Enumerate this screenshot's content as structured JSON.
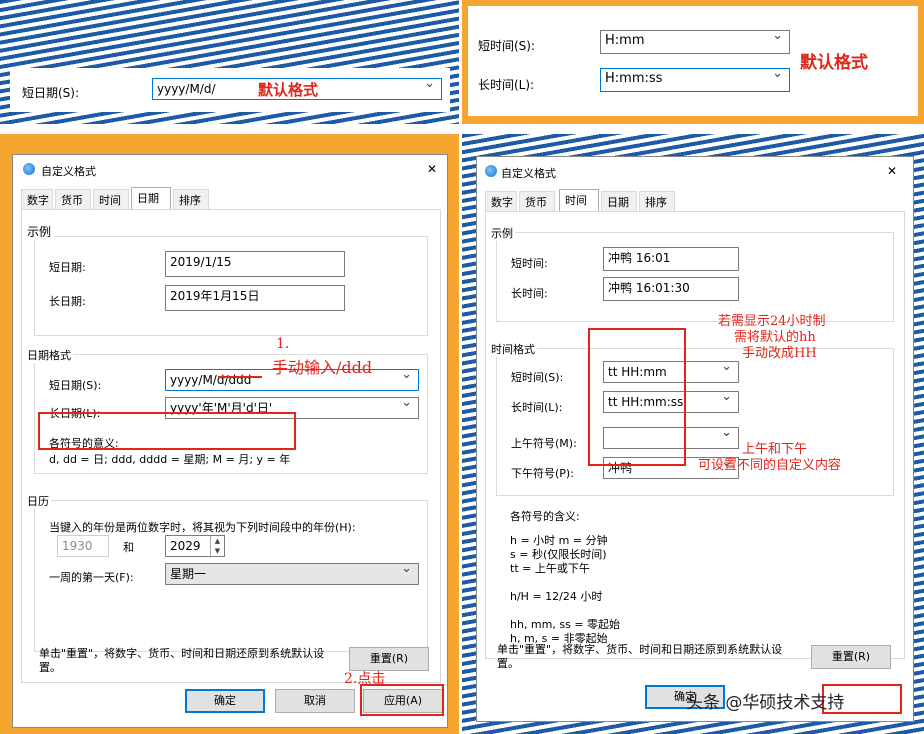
{
  "top_left": {
    "short_date_label": "短日期(S):",
    "short_date_value": "yyyy/M/d/",
    "note": "默认格式"
  },
  "top_right": {
    "short_time_label": "短时间(S):",
    "short_time_value": "H:mm",
    "long_time_label": "长时间(L):",
    "long_time_value": "H:mm:ss",
    "note": "默认格式"
  },
  "left_dialog": {
    "title": "自定义格式",
    "close": "✕",
    "tabs": [
      "数字",
      "货币",
      "时间",
      "日期",
      "排序"
    ],
    "active_tab": "日期",
    "example_group": "示例",
    "short_date_label": "短日期:",
    "short_date_value": "2019/1/15",
    "long_date_label": "长日期:",
    "long_date_value": "2019年1月15日",
    "format_group": "日期格式",
    "short_fmt_label": "短日期(S):",
    "short_fmt_value": "yyyy/M/d/ddd",
    "long_fmt_label": "长日期(L):",
    "long_fmt_value": "yyyy'年'M'月'd'日'",
    "meaning_title": "各符号的意义:",
    "meaning_text": "d, dd = 日;  ddd, dddd = 星期;  M = 月;  y = 年",
    "calendar_group": "日历",
    "calendar_desc": "当键入的年份是两位数字时，将其视为下列时间段中的年份(H):",
    "year_from": "1930",
    "and_label": "和",
    "year_to": "2029",
    "first_day_label": "一周的第一天(F):",
    "first_day_value": "星期一",
    "reset_desc": "单击\"重置\"，将数字、货币、时间和日期还原到系统默认设置。",
    "reset_button": "重置(R)",
    "ok_button": "确定",
    "cancel_button": "取消",
    "apply_button": "应用(A)",
    "annot_step1": "1.",
    "annot_manual": "手动输入/ddd",
    "annot_step2": "2.点击"
  },
  "right_dialog": {
    "title": "自定义格式",
    "close": "✕",
    "tabs": [
      "数字",
      "货币",
      "时间",
      "日期",
      "排序"
    ],
    "active_tab": "时间",
    "example_group": "示例",
    "short_time_label": "短时间:",
    "short_time_value": "冲鸭 16:01",
    "long_time_label": "长时间:",
    "long_time_value": "冲鸭 16:01:30",
    "format_group": "时间格式",
    "short_fmt_label": "短时间(S):",
    "short_fmt_value": "tt HH:mm",
    "long_fmt_label": "长时间(L):",
    "long_fmt_value": "tt HH:mm:ss",
    "am_label": "上午符号(M):",
    "am_value": "",
    "pm_label": "下午符号(P):",
    "pm_value": "冲鸭",
    "meaning_title": "各符号的含义:",
    "meaning_lines": [
      "h = 小时   m = 分钟",
      "s = 秒(仅限长时间)",
      "tt = 上午或下午",
      "",
      "h/H = 12/24 小时",
      "",
      "hh, mm, ss = 零起始",
      "h, m, s = 非零起始"
    ],
    "reset_desc": "单击\"重置\"，将数字、货币、时间和日期还原到系统默认设置。",
    "reset_button": "重置(R)",
    "ok_button": "确定",
    "annot_24h_1": "若需显示24小时制",
    "annot_24h_2": "需将默认的hh",
    "annot_24h_3": "手动改成HH",
    "annot_ampm_1": "上午和下午",
    "annot_ampm_2": "可设置不同的自定义内容",
    "watermark": "头条 @华硕技术支持"
  }
}
